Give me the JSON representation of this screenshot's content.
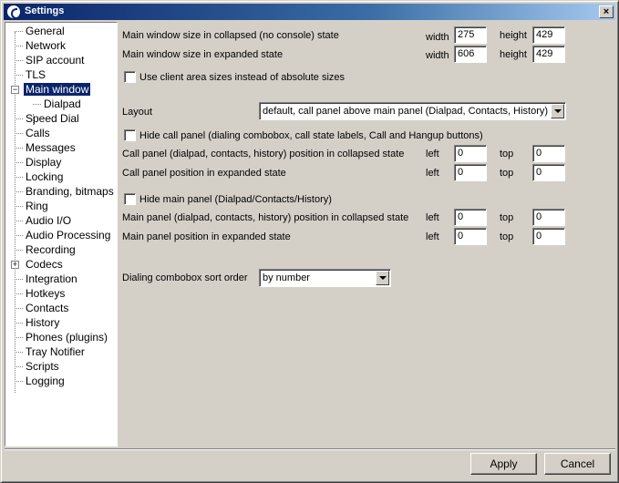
{
  "window": {
    "title": "Settings",
    "close_glyph": "×"
  },
  "tree": {
    "items": [
      {
        "label": "General"
      },
      {
        "label": "Network"
      },
      {
        "label": "SIP account"
      },
      {
        "label": "TLS"
      },
      {
        "label": "Main window",
        "selected": true,
        "expander": "−"
      },
      {
        "label": "Dialpad"
      },
      {
        "label": "Speed Dial"
      },
      {
        "label": "Calls"
      },
      {
        "label": "Messages"
      },
      {
        "label": "Display"
      },
      {
        "label": "Locking"
      },
      {
        "label": "Branding, bitmaps"
      },
      {
        "label": "Ring"
      },
      {
        "label": "Audio I/O"
      },
      {
        "label": "Audio Processing"
      },
      {
        "label": "Recording"
      },
      {
        "label": "Codecs",
        "expander": "+"
      },
      {
        "label": "Integration"
      },
      {
        "label": "Hotkeys"
      },
      {
        "label": "Contacts"
      },
      {
        "label": "History"
      },
      {
        "label": "Phones (plugins)"
      },
      {
        "label": "Tray Notifier"
      },
      {
        "label": "Scripts"
      },
      {
        "label": "Logging"
      }
    ]
  },
  "main": {
    "collapsed_size_label": "Main window size in collapsed (no console) state",
    "expanded_size_label": "Main window size in expanded state",
    "width_label": "width",
    "height_label": "height",
    "collapsed_width": "275",
    "collapsed_height": "429",
    "expanded_width": "606",
    "expanded_height": "429",
    "client_area_label": "Use client area sizes instead of absolute sizes",
    "layout_label": "Layout",
    "layout_value": "default, call panel above main panel (Dialpad, Contacts, History)",
    "hide_call_panel_label": "Hide call panel (dialing combobox, call state labels, Call and Hangup buttons)",
    "call_panel_collapsed_label": "Call panel (dialpad, contacts, history) position in collapsed state",
    "call_panel_expanded_label": "Call panel position in expanded state",
    "hide_main_panel_label": "Hide main panel (Dialpad/Contacts/History)",
    "main_panel_collapsed_label": "Main panel (dialpad, contacts, history) position in collapsed state",
    "main_panel_expanded_label": "Main panel position in expanded state",
    "left_label": "left",
    "top_label": "top",
    "call_collapsed_left": "0",
    "call_collapsed_top": "0",
    "call_expanded_left": "0",
    "call_expanded_top": "0",
    "main_collapsed_left": "0",
    "main_collapsed_top": "0",
    "main_expanded_left": "0",
    "main_expanded_top": "0",
    "sort_order_label": "Dialing combobox sort order",
    "sort_order_value": "by number"
  },
  "buttons": {
    "apply": "Apply",
    "cancel": "Cancel"
  }
}
